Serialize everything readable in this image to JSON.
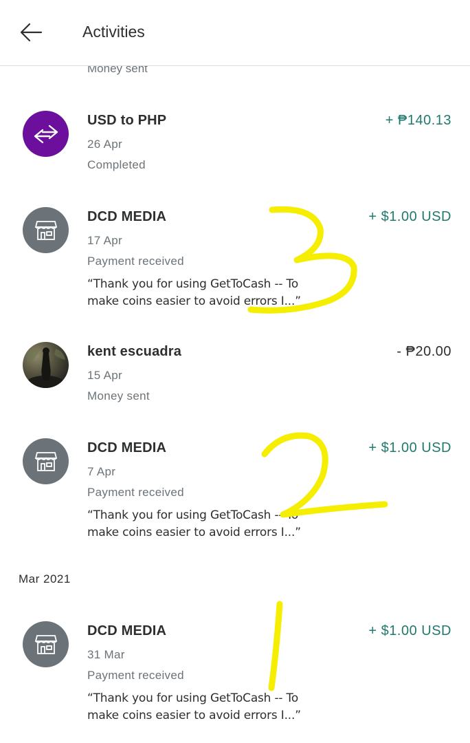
{
  "header": {
    "title": "Activities",
    "back_icon": "arrow-left-icon"
  },
  "partial_row_status": "Money sent",
  "section_label": "Mar 2021",
  "colors": {
    "positive_amount": "#1f7a6d",
    "exchange_avatar": "#6c0f9c",
    "merchant_avatar": "#6c7378",
    "annotation": "#f5ee00"
  },
  "transactions": [
    {
      "name": "USD to PHP",
      "date": "26 Apr",
      "status": "Completed",
      "amount": "+ ₱140.13",
      "icon": "currency-exchange-icon"
    },
    {
      "name": "DCD MEDIA",
      "date": "17 Apr",
      "status": "Payment received",
      "note_line1": "“Thank you for using GetToCash -- To",
      "note_line2": "make coins easier to avoid errors I...”",
      "amount": "+ $1.00 USD",
      "icon": "store-icon"
    },
    {
      "name": "kent escuadra",
      "date": "15 Apr",
      "status": "Money sent",
      "amount": "- ₱20.00",
      "icon": "profile-photo"
    },
    {
      "name": "DCD MEDIA",
      "date": "7 Apr",
      "status": "Payment received",
      "note_line1": "“Thank you for using GetToCash -- To",
      "note_line2": "make coins easier to avoid errors I...”",
      "amount": "+ $1.00 USD",
      "icon": "store-icon"
    },
    {
      "name": "DCD MEDIA",
      "date": "31 Mar",
      "status": "Payment received",
      "note_line1": "“Thank you for using GetToCash -- To",
      "note_line2": "make coins easier to avoid errors I...”",
      "amount": "+ $1.00 USD",
      "icon": "store-icon"
    }
  ],
  "annotations": [
    "3",
    "2",
    "1"
  ]
}
